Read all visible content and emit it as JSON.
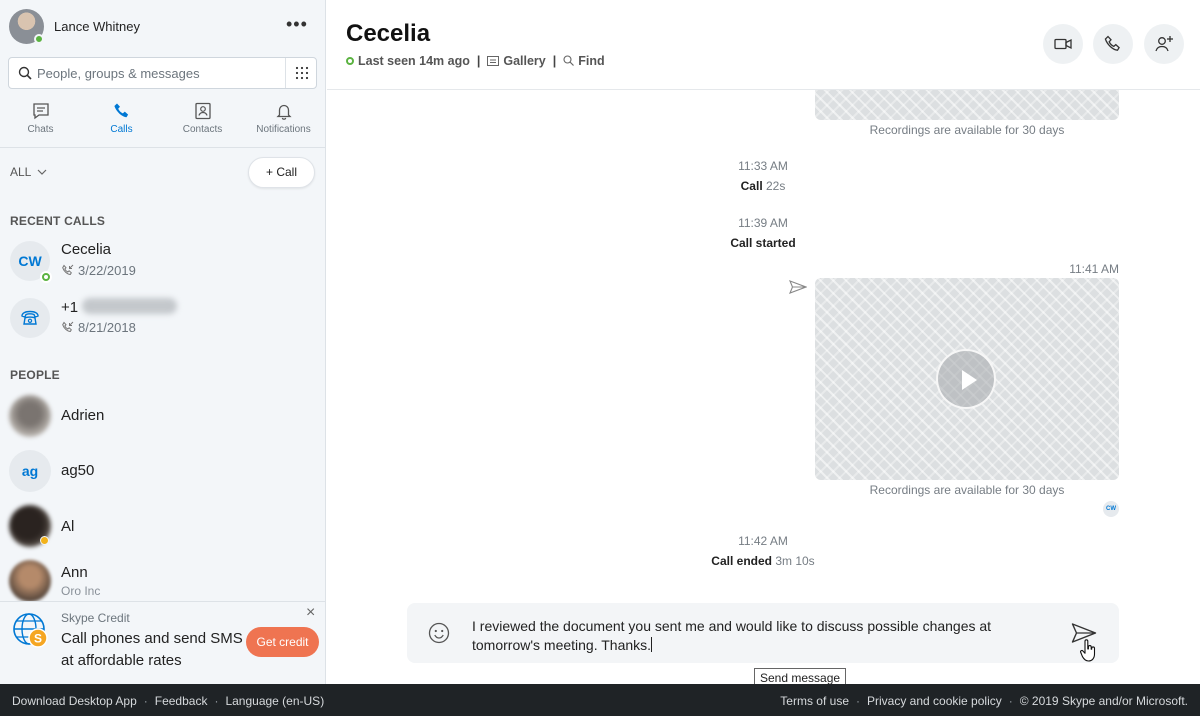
{
  "profile": {
    "name": "Lance Whitney"
  },
  "search": {
    "placeholder": "People, groups & messages"
  },
  "nav": {
    "tabs": [
      {
        "label": "Chats",
        "icon": "chat-icon"
      },
      {
        "label": "Calls",
        "icon": "phone-icon",
        "active": true
      },
      {
        "label": "Contacts",
        "icon": "contacts-icon"
      },
      {
        "label": "Notifications",
        "icon": "bell-icon"
      }
    ]
  },
  "filter": {
    "label": "ALL",
    "call_button": "+ Call"
  },
  "recent_calls": {
    "title": "RECENT CALLS",
    "items": [
      {
        "initials": "CW",
        "name": "Cecelia",
        "date": "3/22/2019"
      },
      {
        "name": "+1",
        "date": "8/21/2018"
      }
    ]
  },
  "people": {
    "title": "PEOPLE",
    "items": [
      {
        "name": "Adrien"
      },
      {
        "initials": "ag",
        "name": "ag50"
      },
      {
        "name": "Al"
      },
      {
        "name": "Ann",
        "subtitle": "Oro Inc"
      }
    ]
  },
  "credit": {
    "title": "Skype Credit",
    "text": "Call phones and send SMS at affordable rates",
    "button": "Get credit"
  },
  "chat": {
    "title": "Cecelia",
    "status": "Last seen 14m ago",
    "gallery": "Gallery",
    "find": "Find"
  },
  "messages": {
    "rec_note_1": "Recordings are available for 30 days",
    "time_1": "11:33 AM",
    "event_1": "Call",
    "event_1_duration": "22s",
    "time_2": "11:39 AM",
    "event_2": "Call started",
    "time_3": "11:41 AM",
    "rec_note_2": "Recordings are available for 30 days",
    "read_initials": "CW",
    "time_4": "11:42 AM",
    "event_3": "Call ended",
    "event_3_duration": "3m 10s"
  },
  "composer": {
    "text": "I reviewed the document you sent me and would like to discuss possible changes at tomorrow's meeting. Thanks.",
    "tooltip": "Send message"
  },
  "footer": {
    "download": "Download Desktop App",
    "feedback": "Feedback",
    "language": "Language (en-US)",
    "terms": "Terms of use",
    "privacy": "Privacy and cookie policy",
    "copyright": "© 2019 Skype and/or Microsoft."
  },
  "colors": {
    "accent": "#0078d4",
    "online": "#5bb341",
    "credit_button": "#ef7451",
    "footer_bg": "#1f2326"
  }
}
